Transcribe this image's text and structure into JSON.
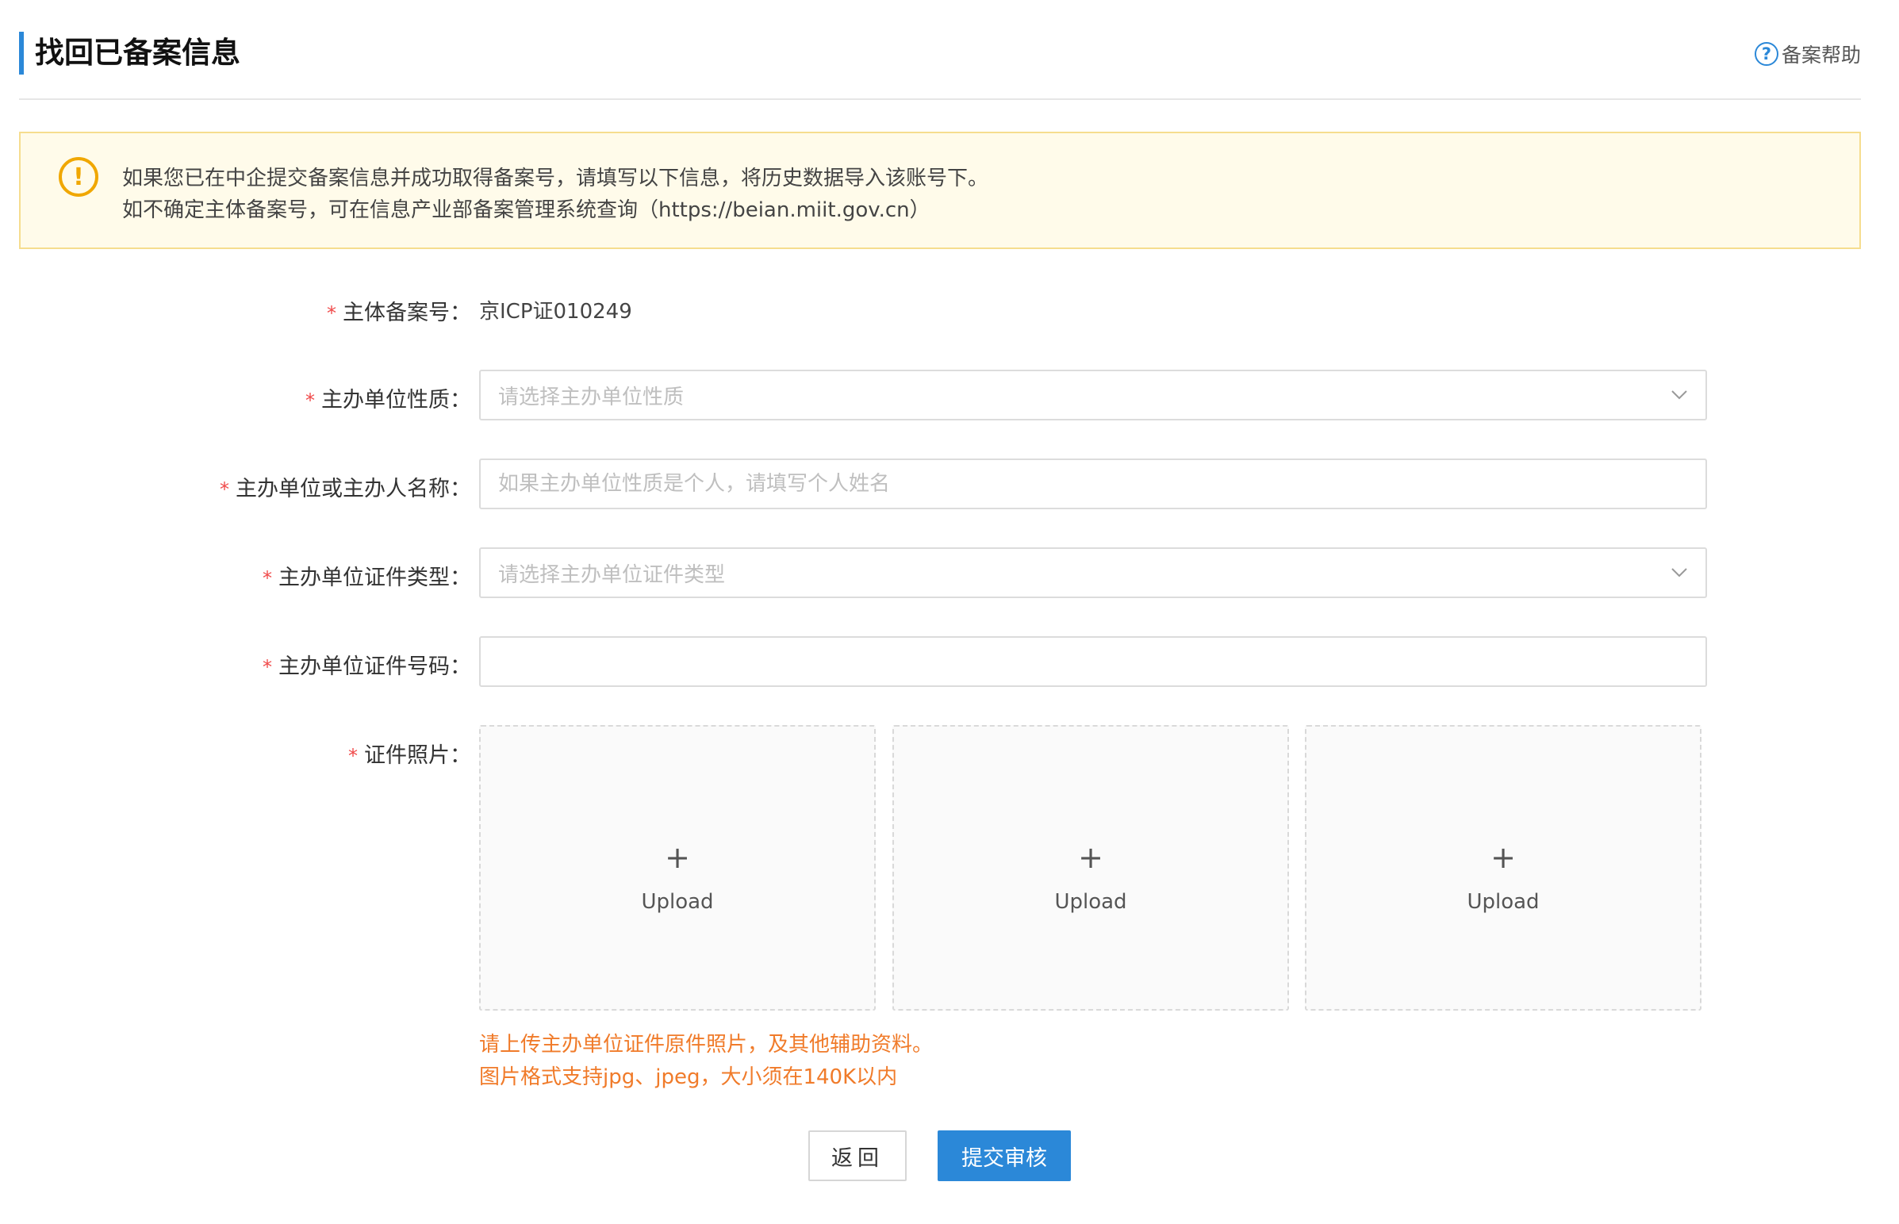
{
  "header": {
    "title": "找回已备案信息",
    "help_label": "备案帮助",
    "help_icon": "question-circle-icon"
  },
  "notice": {
    "icon": "exclamation-circle-icon",
    "line1": "如果您已在中企提交备案信息并成功取得备案号，请填写以下信息，将历史数据导入该账号下。",
    "line2": "如不确定主体备案号，可在信息产业部备案管理系统查询（https://beian.miit.gov.cn）"
  },
  "form": {
    "required_mark": "*",
    "record_no": {
      "label": "主体备案号：",
      "value": "京ICP证010249"
    },
    "unit_nature": {
      "label": "主办单位性质：",
      "placeholder": "请选择主办单位性质"
    },
    "unit_name": {
      "label": "主办单位或主办人名称：",
      "placeholder": "如果主办单位性质是个人，请填写个人姓名",
      "value": ""
    },
    "cert_type": {
      "label": "主办单位证件类型：",
      "placeholder": "请选择主办单位证件类型"
    },
    "cert_no": {
      "label": "主办单位证件号码：",
      "placeholder": "",
      "value": ""
    },
    "photos": {
      "label": "证件照片：",
      "uploads": [
        {
          "plus": "+",
          "label": "Upload"
        },
        {
          "plus": "+",
          "label": "Upload"
        },
        {
          "plus": "+",
          "label": "Upload"
        }
      ],
      "tip1": "请上传主办单位证件原件照片，及其他辅助资料。",
      "tip2": "图片格式支持jpg、jpeg，大小须在140K以内"
    }
  },
  "actions": {
    "back_label": "返回",
    "submit_label": "提交审核"
  },
  "colors": {
    "accent": "#2b88d8",
    "warning": "#f0a700",
    "notice_bg": "#fffbea",
    "tip": "#f07b2a",
    "required": "#f04a4a"
  }
}
